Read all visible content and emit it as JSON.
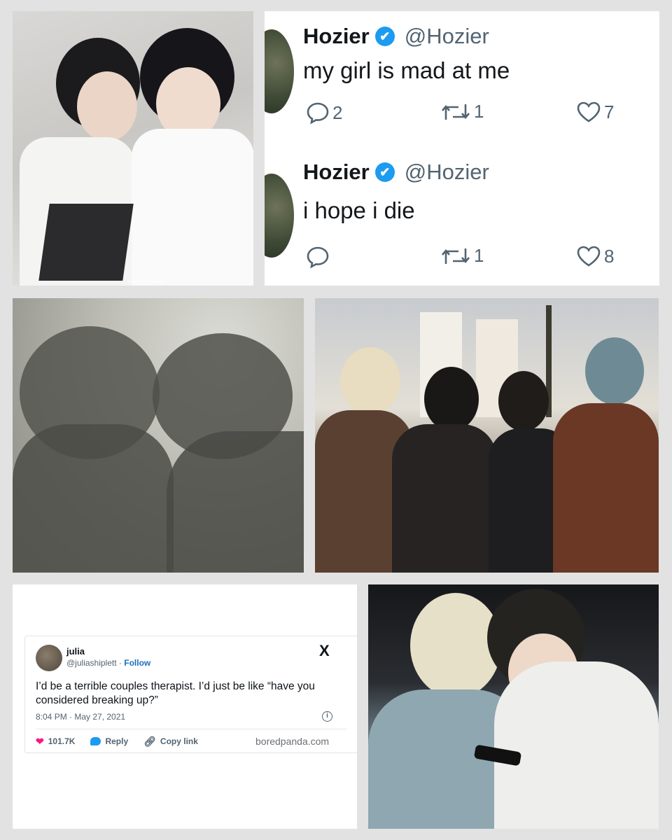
{
  "hozier_tweets": [
    {
      "name": "Hozier",
      "verified_mark": "✔",
      "handle": "@Hozier",
      "text": "my girl is mad at me",
      "replies": "2",
      "retweets": "1",
      "likes": "7"
    },
    {
      "name": "Hozier",
      "verified_mark": "✔",
      "handle": "@Hozier",
      "text": "i hope i die",
      "replies": "",
      "retweets": "1",
      "likes": "8"
    }
  ],
  "julia_tweet": {
    "name": "julia",
    "handle": "@juliashiplett",
    "separator": "·",
    "follow_label": "Follow",
    "x_logo": "X",
    "text": "I’d be a terrible couples therapist. I’d just be like “have you considered breaking up?”",
    "timestamp": "8:04 PM · May 27, 2021",
    "info_glyph": "i",
    "likes": "101.7K",
    "reply_label": "Reply",
    "copy_link_label": "Copy link",
    "source": "boredpanda.com"
  },
  "icons": {
    "reply": "speech-bubble-icon",
    "retweet": "retweet-icon",
    "like": "heart-icon",
    "verified": "verified-badge-icon"
  },
  "colors": {
    "twitter_blue": "#1d9bf0",
    "like_pink": "#f91880",
    "text_primary": "#14171a",
    "text_secondary": "#536471",
    "page_background": "#e2e2e2"
  },
  "watermark": "fee@rose_chenhee"
}
